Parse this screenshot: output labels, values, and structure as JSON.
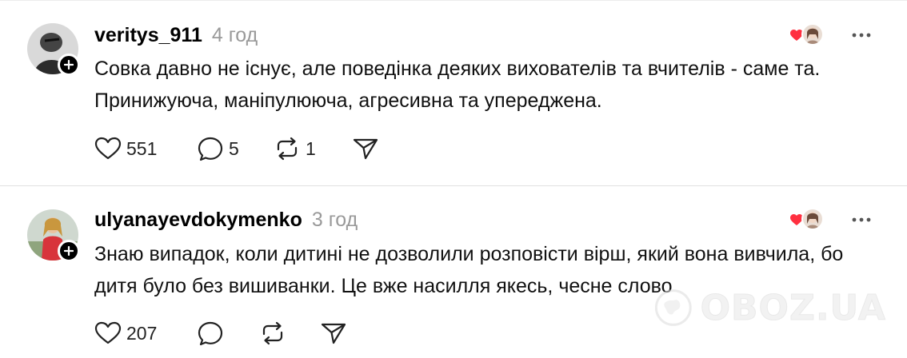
{
  "posts": [
    {
      "username": "veritys_911",
      "time": "4 год",
      "text": "Совка давно не існує, але поведінка деяких вихователів та вчителів - саме та. Принижуюча, маніпулююча, агресивна та упереджена.",
      "likes": "551",
      "replies": "5",
      "reposts": "1"
    },
    {
      "username": "ulyanayevdokymenko",
      "time": "3 год",
      "text": "Знаю випадок, коли дитині не дозволили розповісти вірш, який вона вивчила, бо дитя було без вишиванки. Це вже насилля якесь, чесне слово",
      "likes": "207",
      "replies": "",
      "reposts": ""
    }
  ],
  "watermark": "OBOZ.UA",
  "icons": {
    "like": "heart-icon",
    "reply": "comment-icon",
    "repost": "repost-icon",
    "share": "send-icon",
    "more": "more-icon",
    "follow": "plus-icon",
    "liked_by_author": "heart-badge-icon"
  },
  "colors": {
    "heart_red": "#ff3040",
    "muted": "#9a9a9a"
  }
}
